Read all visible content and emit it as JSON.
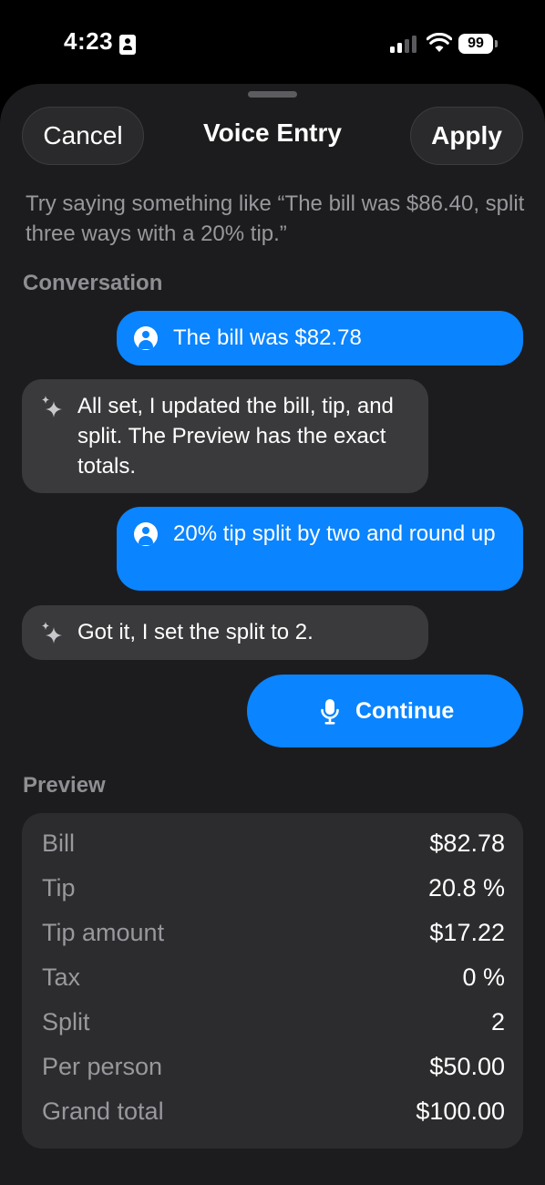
{
  "status_bar": {
    "time": "4:23",
    "battery": "99"
  },
  "sheet": {
    "cancel_label": "Cancel",
    "title": "Voice Entry",
    "apply_label": "Apply",
    "hint": "Try saying something like “The bill was $86.40, split three ways with a 20% tip.”"
  },
  "conversation": {
    "label": "Conversation",
    "messages": [
      {
        "role": "user",
        "text": "The bill was $82.78"
      },
      {
        "role": "assistant",
        "text": "All set, I updated the bill, tip, and split. The Preview has the exact totals."
      },
      {
        "role": "user",
        "text": "20% tip split by two and round up"
      },
      {
        "role": "assistant",
        "text": "Got it, I set the split to 2."
      }
    ],
    "continue_label": "Continue"
  },
  "preview": {
    "label": "Preview",
    "rows": [
      {
        "key": "Bill",
        "value": "$82.78"
      },
      {
        "key": "Tip",
        "value": "20.8 %"
      },
      {
        "key": "Tip amount",
        "value": "$17.22"
      },
      {
        "key": "Tax",
        "value": "0 %"
      },
      {
        "key": "Split",
        "value": "2"
      },
      {
        "key": "Per person",
        "value": "$50.00"
      },
      {
        "key": "Grand total",
        "value": "$100.00"
      }
    ]
  },
  "colors": {
    "accent": "#0a84ff",
    "background": "#000000",
    "sheet": "#1c1c1e",
    "assistant_bubble": "#3a3a3c",
    "card": "#2c2c2e",
    "secondary_text": "#98989d"
  },
  "icons": {
    "user_message": "person-circle-icon",
    "assistant_message": "sparkle-icon",
    "continue": "microphone-icon",
    "status": [
      "id-card-icon",
      "cellular-signal-icon",
      "wifi-icon",
      "battery-icon"
    ]
  }
}
